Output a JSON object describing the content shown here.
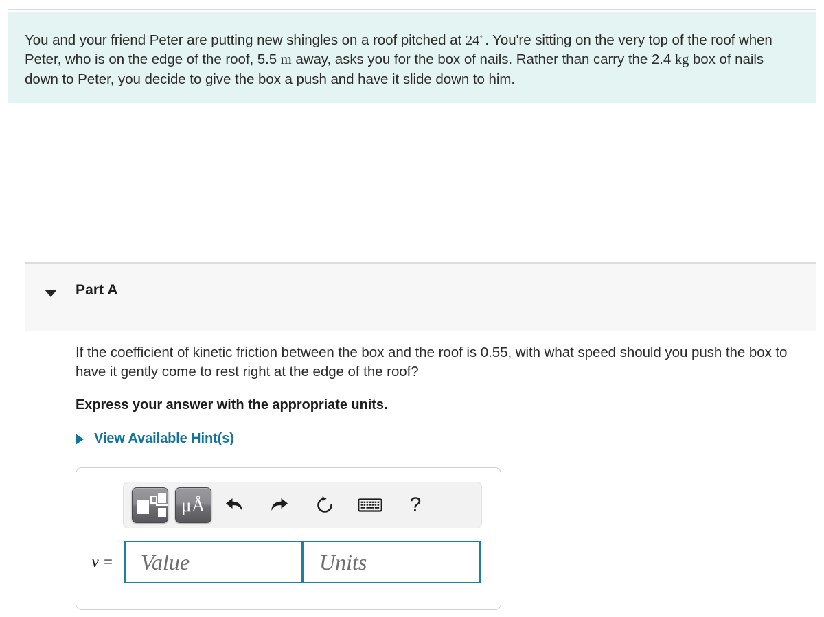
{
  "problem": {
    "segments": [
      {
        "t": "text",
        "v": "You and your friend Peter are putting new shingles on a roof pitched at "
      },
      {
        "t": "math",
        "v": "24°"
      },
      {
        "t": "text",
        "v": " . You're sitting on the very top of the roof when Peter, who is on the edge of the roof, 5.5 "
      },
      {
        "t": "math",
        "v": "m"
      },
      {
        "t": "text",
        "v": " away, asks you for the box of nails. Rather than carry the 2.4 "
      },
      {
        "t": "math",
        "v": "kg"
      },
      {
        "t": "text",
        "v": " box of nails down to Peter, you decide to give the box a push and have it slide down to him."
      }
    ],
    "text_part_1": "You and your friend Peter are putting new shingles on a roof pitched at ",
    "angle_value": "24",
    "degree_symbol": "◦",
    "text_part_2": ". You're sitting on the very top of the roof when Peter, who is on the edge of the roof, 5.5 ",
    "unit_m": "m",
    "text_part_3": " away, asks you for the box of nails. Rather than carry the 2.4 ",
    "unit_kg": "kg",
    "text_part_4": " box of nails down to Peter, you decide to give the box a push and have it slide down to him.",
    "background_color": "#e4f4f2"
  },
  "part": {
    "title": "Part A",
    "toggle_icon": "triangle-down-icon",
    "expanded": true,
    "band_color": "#f7f7f7"
  },
  "question": {
    "prompt": "If the coefficient of kinetic friction between the box and the roof is 0.55, with what speed should you push the box to have it gently come to rest right at the edge of the roof?",
    "coefficient": "0.55",
    "instruction": "Express your answer with the appropriate units."
  },
  "hints": {
    "label": "View Available Hint(s)",
    "icon": "triangle-right-icon",
    "color": "#12749b",
    "expanded": false
  },
  "answer": {
    "toolbar": {
      "buttons": [
        {
          "name": "math-template-button",
          "icon": "math-template-icon",
          "label": ""
        },
        {
          "name": "units-button",
          "icon": "mu-angstrom-icon",
          "label": "μÅ"
        },
        {
          "name": "undo-button",
          "icon": "undo-arrow-icon",
          "label": ""
        },
        {
          "name": "redo-button",
          "icon": "redo-arrow-icon",
          "label": ""
        },
        {
          "name": "reset-button",
          "icon": "reset-circular-arrow-icon",
          "label": ""
        },
        {
          "name": "keyboard-button",
          "icon": "keyboard-icon",
          "label": ""
        },
        {
          "name": "help-button",
          "icon": "question-mark-icon",
          "label": "?"
        }
      ],
      "units_button_label": "μÅ",
      "help_button_label": "?"
    },
    "variable_label": "v =",
    "value_placeholder": "Value",
    "units_placeholder": "Units",
    "value_current": "",
    "units_current": "",
    "field_border_color": "#1f7fa0"
  }
}
